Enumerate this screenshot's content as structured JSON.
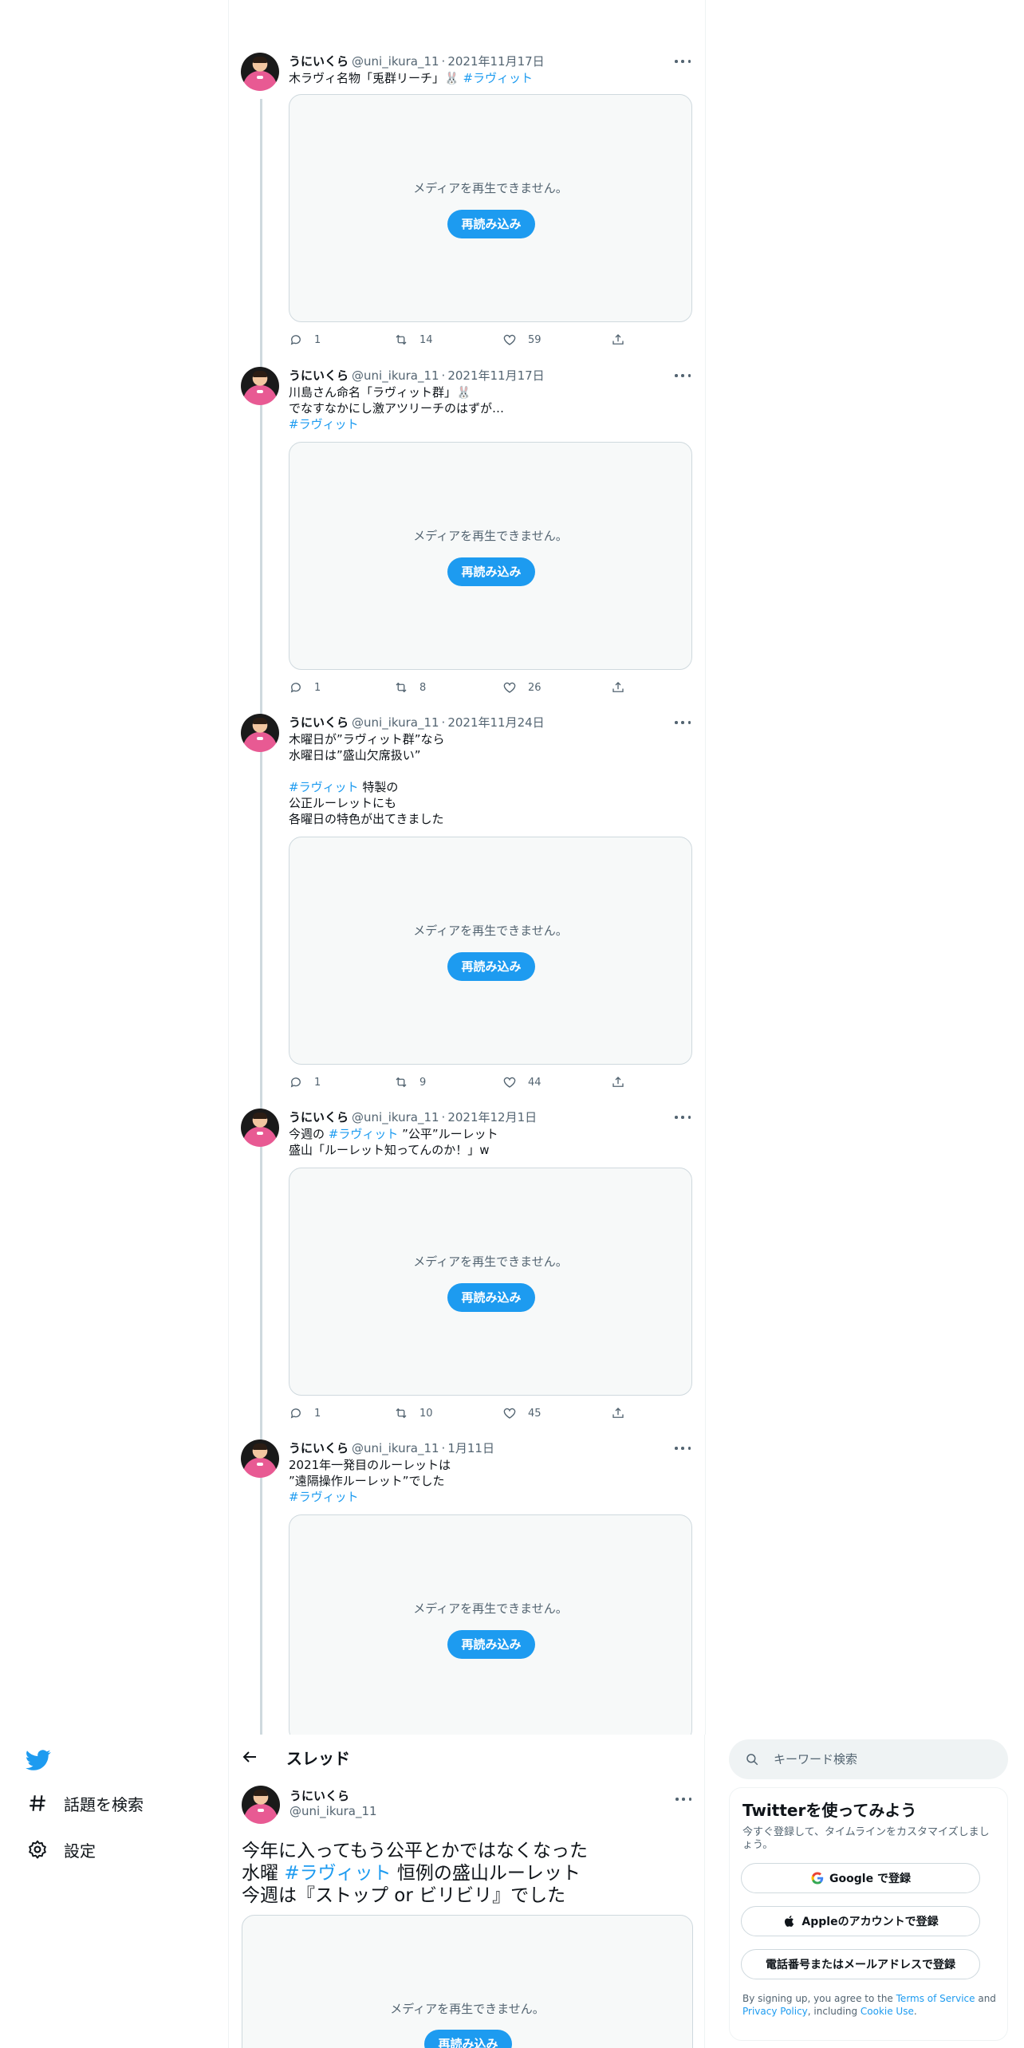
{
  "thread": [
    {
      "name": "うにいくら",
      "handle": "@uni_ikura_11",
      "date": "2021年11月17日",
      "text_parts": [
        "木ラヴィ名物「兎群リーチ」🐰 ",
        "#ラヴィット"
      ],
      "media_message": "メディアを再生できません。",
      "reload_label": "再読み込み",
      "replies": "1",
      "retweets": "14",
      "likes": "59"
    },
    {
      "name": "うにいくら",
      "handle": "@uni_ikura_11",
      "date": "2021年11月17日",
      "text_parts": [
        "川島さん命名「ラヴィット群」🐰\nでなすなかにし激アツリーチのはずが…\n",
        "#ラヴィット"
      ],
      "media_message": "メディアを再生できません。",
      "reload_label": "再読み込み",
      "replies": "1",
      "retweets": "8",
      "likes": "26"
    },
    {
      "name": "うにいくら",
      "handle": "@uni_ikura_11",
      "date": "2021年11月24日",
      "text_parts": [
        "木曜日が”ラヴィット群”なら\n水曜日は”盛山欠席扱い”\n\n",
        "#ラヴィット",
        " 特製の\n公正ルーレットにも\n各曜日の特色が出てきました"
      ],
      "media_message": "メディアを再生できません。",
      "reload_label": "再読み込み",
      "replies": "1",
      "retweets": "9",
      "likes": "44"
    },
    {
      "name": "うにいくら",
      "handle": "@uni_ikura_11",
      "date": "2021年12月1日",
      "text_parts": [
        "今週の ",
        "#ラヴィット",
        " ”公平”ルーレット\n盛山「ルーレット知ってんのか！」w"
      ],
      "media_message": "メディアを再生できません。",
      "reload_label": "再読み込み",
      "replies": "1",
      "retweets": "10",
      "likes": "45"
    },
    {
      "name": "うにいくら",
      "handle": "@uni_ikura_11",
      "date": "1月11日",
      "text_parts": [
        "2021年一発目のルーレットは\n”遠隔操作ルーレット”でした\n",
        "#ラヴィット"
      ],
      "media_message": "メディアを再生できません。",
      "reload_label": "再読み込み"
    }
  ],
  "nav": {
    "explore_label": "話題を検索",
    "settings_label": "設定"
  },
  "header": {
    "title": "スレッド"
  },
  "main_tweet": {
    "name": "うにいくら",
    "handle": "@uni_ikura_11",
    "text_parts": [
      "今年に入ってもう公平とかではなくなった\n水曜 ",
      "#ラヴィット",
      " 恒例の盛山ルーレット\n今週は『ストップ or ビリビリ』でした"
    ],
    "media_message": "メディアを再生できません。",
    "reload_label": "再読み込み"
  },
  "search": {
    "placeholder": "キーワード検索"
  },
  "signup": {
    "title": "Twitterを使ってみよう",
    "subtitle": "今すぐ登録して、タイムラインをカスタマイズしましょう。",
    "google_label": "Google で登録",
    "apple_label": "Appleのアカウントで登録",
    "phone_label": "電話番号またはメールアドレスで登録",
    "legal_1": "By signing up, you agree to the ",
    "terms_label": "Terms of Service",
    "legal_2": " and ",
    "privacy_label": "Privacy Policy",
    "legal_3": ", including ",
    "cookie_label": "Cookie Use",
    "legal_4": "."
  },
  "colors": {
    "accent": "#1d9bf0",
    "text": "#0f1419",
    "muted": "#536471",
    "border": "#cfd9de"
  },
  "icons": [
    "twitter-logo-icon",
    "hashtag-icon",
    "gear-icon",
    "back-arrow-icon",
    "reply-icon",
    "retweet-icon",
    "like-icon",
    "share-icon",
    "more-icon",
    "search-icon",
    "google-icon",
    "apple-icon"
  ]
}
